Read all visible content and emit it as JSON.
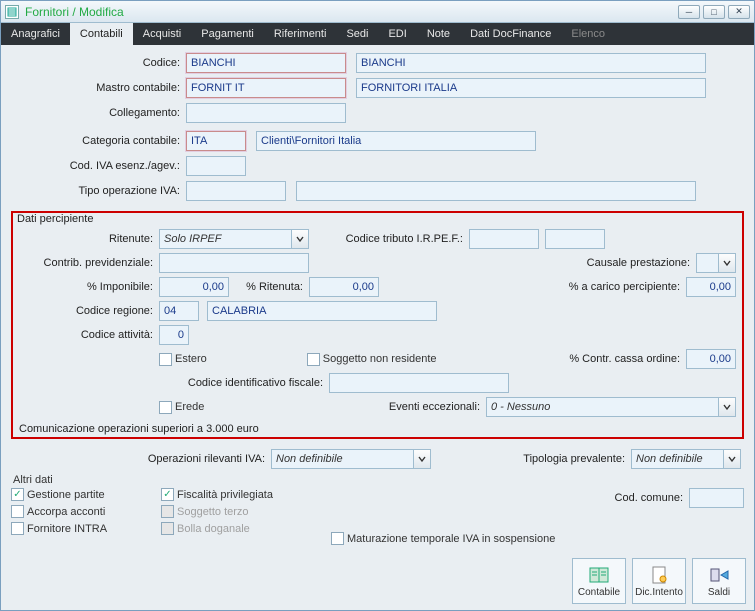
{
  "window": {
    "title": "Fornitori / Modifica"
  },
  "tabs": {
    "items": [
      "Anagrafici",
      "Contabili",
      "Acquisti",
      "Pagamenti",
      "Riferimenti",
      "Sedi",
      "EDI",
      "Note",
      "Dati DocFinance",
      "Elenco"
    ],
    "active": "Contabili",
    "disabled": "Elenco"
  },
  "top": {
    "codice_label": "Codice:",
    "codice_value": "BIANCHI",
    "codice_desc": "BIANCHI",
    "mastro_label": "Mastro contabile:",
    "mastro_value": "FORNIT IT",
    "mastro_desc": "FORNITORI ITALIA",
    "collegamento_label": "Collegamento:",
    "collegamento_value": "",
    "categoria_label": "Categoria contabile:",
    "categoria_value": "ITA",
    "categoria_desc": "Clienti\\Fornitori Italia",
    "codiva_label": "Cod. IVA esenz./agev.:",
    "codiva_value": "",
    "tipoop_label": "Tipo operazione IVA:",
    "tipoop_value": ""
  },
  "percipiente": {
    "legend": "Dati percipiente",
    "ritenute_label": "Ritenute:",
    "ritenute_value": "Solo IRPEF",
    "tributo_label": "Codice tributo I.R.PE.F.:",
    "tributo_value": "",
    "causale_label": "Causale prestazione:",
    "causale_value": "",
    "contrib_label": "Contrib. previdenziale:",
    "contrib_value": "",
    "imponibile_label": "% Imponibile:",
    "imponibile_value": "0,00",
    "ritenuta_label": "% Ritenuta:",
    "ritenuta_value": "0,00",
    "carico_label": "% a carico percipiente:",
    "carico_value": "0,00",
    "regione_label": "Codice regione:",
    "regione_value": "04",
    "regione_desc": "CALABRIA",
    "attivita_label": "Codice attività:",
    "attivita_value": "0",
    "estero_label": "Estero",
    "soggetto_label": "Soggetto non residente",
    "cassa_label": "% Contr. cassa ordine:",
    "cassa_value": "0,00",
    "idfiscale_label": "Codice identificativo fiscale:",
    "idfiscale_value": "",
    "erede_label": "Erede",
    "eventi_label": "Eventi eccezionali:",
    "eventi_value": "0 - Nessuno",
    "comunicazione": "Comunicazione operazioni superiori a 3.000 euro"
  },
  "bottom": {
    "oprilevanti_label": "Operazioni rilevanti IVA:",
    "oprilevanti_value": "Non definibile",
    "tipologia_label": "Tipologia prevalente:",
    "tipologia_value": "Non definibile",
    "altri_label": "Altri dati",
    "gestione_partite": "Gestione partite",
    "fiscalita": "Fiscalità privilegiata",
    "codcomune_label": "Cod. comune:",
    "codcomune_value": "",
    "accorpa": "Accorpa acconti",
    "soggettoterzo": "Soggetto terzo",
    "fornitoreintra": "Fornitore INTRA",
    "bolla": "Bolla doganale",
    "maturazione": "Maturazione temporale IVA in sospensione"
  },
  "buttons": {
    "contabile": "Contabile",
    "dicintento": "Dic.Intento",
    "saldi": "Saldi"
  }
}
